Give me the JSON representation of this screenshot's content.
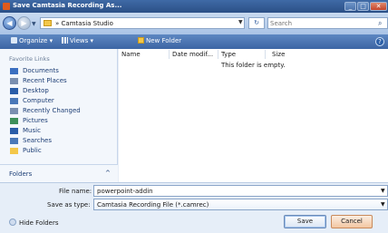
{
  "window": {
    "title": "Save Camtasia Recording As..."
  },
  "address": {
    "path": "Camtasia Studio",
    "search_placeholder": "Search"
  },
  "toolbar": {
    "organize": "Organize",
    "views": "Views",
    "new_folder": "New Folder"
  },
  "sidebar": {
    "title": "Favorite Links",
    "items": [
      {
        "label": "Documents",
        "icon": "documents-icon",
        "color": "#3b6fc0"
      },
      {
        "label": "Recent Places",
        "icon": "recent-places-icon",
        "color": "#7a8fb0"
      },
      {
        "label": "Desktop",
        "icon": "desktop-icon",
        "color": "#2a5da8"
      },
      {
        "label": "Computer",
        "icon": "computer-icon",
        "color": "#4a78b8"
      },
      {
        "label": "Recently Changed",
        "icon": "recently-changed-icon",
        "color": "#7a8fb0"
      },
      {
        "label": "Pictures",
        "icon": "pictures-icon",
        "color": "#3d8f5a"
      },
      {
        "label": "Music",
        "icon": "music-icon",
        "color": "#2a5da8"
      },
      {
        "label": "Searches",
        "icon": "searches-icon",
        "color": "#4a78b8"
      },
      {
        "label": "Public",
        "icon": "public-icon",
        "color": "#f3c74a"
      }
    ],
    "folders_label": "Folders"
  },
  "file_list": {
    "columns": [
      "Name",
      "Date modif...",
      "Type",
      "Size"
    ],
    "empty_message": "This folder is empty."
  },
  "form": {
    "file_name_label": "File name:",
    "file_name_value": "powerpoint-addin",
    "save_type_label": "Save as type:",
    "save_type_value": "Camtasia Recording File (*.camrec)"
  },
  "footer": {
    "hide_folders": "Hide Folders",
    "save": "Save",
    "cancel": "Cancel"
  }
}
